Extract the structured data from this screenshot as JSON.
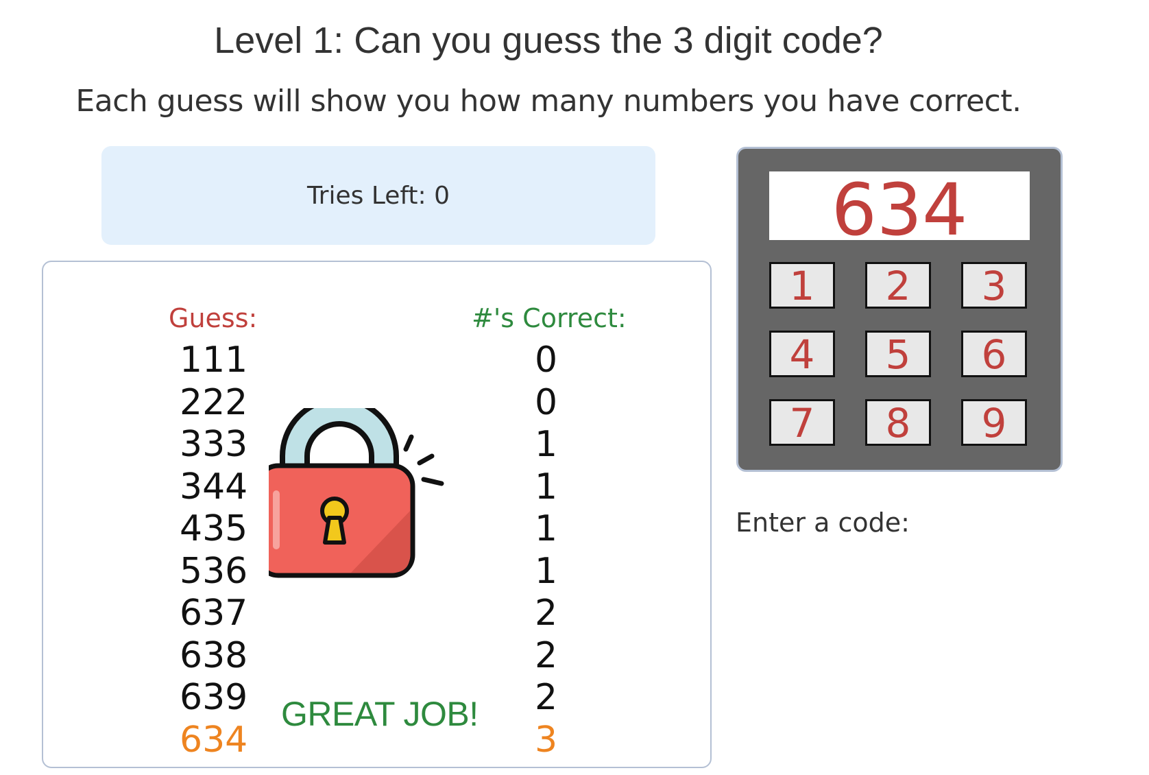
{
  "header": {
    "title": "Level 1: Can you guess the 3 digit code?",
    "subtitle": "Each guess will show you how many numbers you have correct."
  },
  "status": {
    "tries_left": "Tries Left: 0"
  },
  "history": {
    "guess_heading": "Guess:",
    "correct_heading": "#'s Correct:",
    "guesses": [
      "111",
      "222",
      "333",
      "344",
      "435",
      "536",
      "637",
      "638",
      "639",
      "634"
    ],
    "corrects": [
      "0",
      "0",
      "1",
      "1",
      "1",
      "1",
      "2",
      "2",
      "2",
      "3"
    ],
    "winning_index": 9,
    "message": "GREAT JOB!",
    "lock_icon": "unlocked-padlock-icon"
  },
  "keypad": {
    "display": "634",
    "keys": [
      "1",
      "2",
      "3",
      "4",
      "5",
      "6",
      "7",
      "8",
      "9"
    ]
  },
  "input": {
    "label": "Enter a code:"
  },
  "colors": {
    "guess_heading": "#c0403c",
    "correct_heading": "#2e8a3e",
    "winner": "#ee8420",
    "keypad_body": "#666666",
    "key_digit": "#c0403c",
    "tries_bg": "#e3f0fc"
  }
}
